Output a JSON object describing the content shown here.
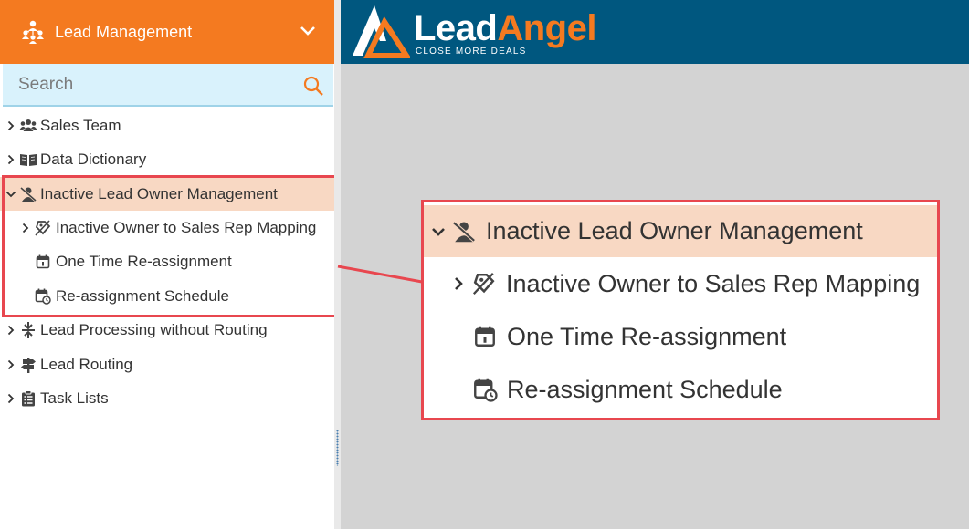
{
  "sidebar": {
    "header": {
      "title": "Lead Management",
      "icon": "team-network-icon",
      "toggle_icon": "chevron-down-icon"
    },
    "search": {
      "placeholder": "Search",
      "icon": "search-icon"
    },
    "tree": {
      "items": [
        {
          "label": "Sales Team",
          "icon": "users-icon",
          "expanded": false
        },
        {
          "label": "Data Dictionary",
          "icon": "book-open-icon",
          "expanded": false
        },
        {
          "label": "Inactive Lead Owner Management",
          "icon": "user-slash-icon",
          "expanded": true,
          "selected": true,
          "children": [
            {
              "label": "Inactive Owner to Sales Rep Mapping",
              "icon": "user-tag-icon",
              "expandable": true
            },
            {
              "label": "One Time Re-assignment",
              "icon": "calendar-day-icon",
              "expandable": false
            },
            {
              "label": "Re-assignment Schedule",
              "icon": "calendar-clock-icon",
              "expandable": false
            }
          ]
        },
        {
          "label": "Lead Processing without Routing",
          "icon": "split-arrows-icon",
          "expanded": false
        },
        {
          "label": "Lead Routing",
          "icon": "signpost-icon",
          "expanded": false
        },
        {
          "label": "Task Lists",
          "icon": "clipboard-list-icon",
          "expanded": false
        }
      ]
    }
  },
  "brand": {
    "name_part1": "Lead",
    "name_part2": "Angel",
    "tagline": "CLOSE MORE DEALS",
    "colors": {
      "primary": "#00577f",
      "accent": "#f47a20"
    }
  },
  "callout": {
    "title": "Inactive Lead Owner Management",
    "items": [
      "Inactive Owner to Sales Rep Mapping",
      "One Time Re-assignment",
      "Re-assignment Schedule"
    ],
    "highlight_color": "#e8474f"
  }
}
